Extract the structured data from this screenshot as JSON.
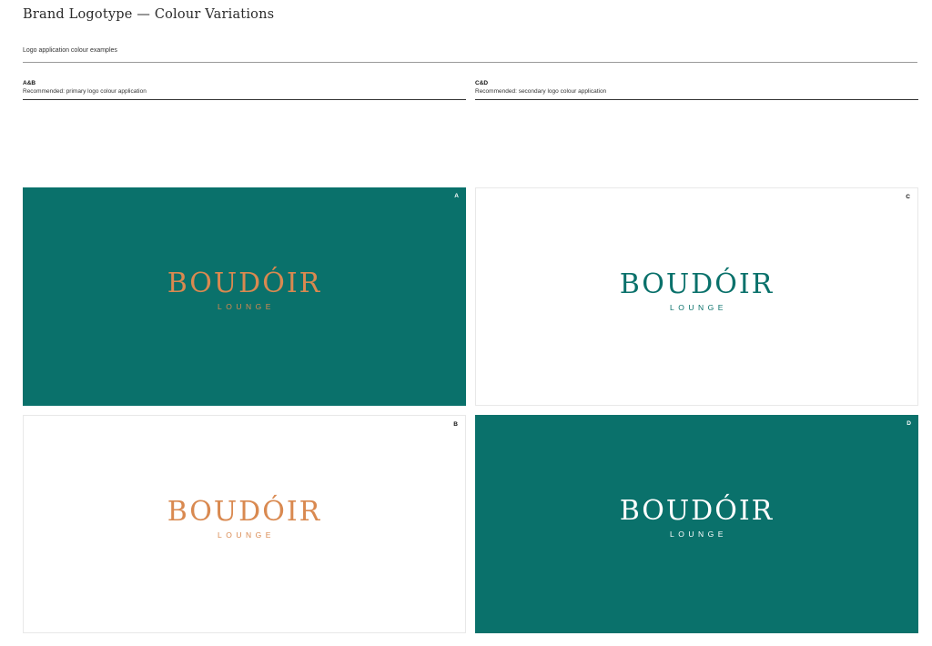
{
  "header": {
    "title": "Brand Logotype — Colour Variations",
    "subtitle": "Logo application colour examples"
  },
  "sections": [
    {
      "code": "A&B",
      "description": "Recommended: primary logo colour application"
    },
    {
      "code": "C&D",
      "description": "Recommended: secondary logo colour application"
    }
  ],
  "colors": {
    "teal": "#0a716b",
    "copper": "#d98950",
    "white": "#ffffff"
  },
  "panels": {
    "a": {
      "letter": "A",
      "background": "teal",
      "logo_color": "copper",
      "logo_main": "BOUDÓIR",
      "logo_sub": "LOUNGE"
    },
    "b": {
      "letter": "B",
      "background": "white",
      "logo_color": "copper",
      "logo_main": "BOUDÓIR",
      "logo_sub": "LOUNGE"
    },
    "c": {
      "letter": "C",
      "background": "white",
      "logo_color": "teal",
      "logo_main": "BOUDÓIR",
      "logo_sub": "LOUNGE"
    },
    "d": {
      "letter": "D",
      "background": "teal",
      "logo_color": "white",
      "logo_main": "BOUDÓIR",
      "logo_sub": "LOUNGE"
    }
  }
}
